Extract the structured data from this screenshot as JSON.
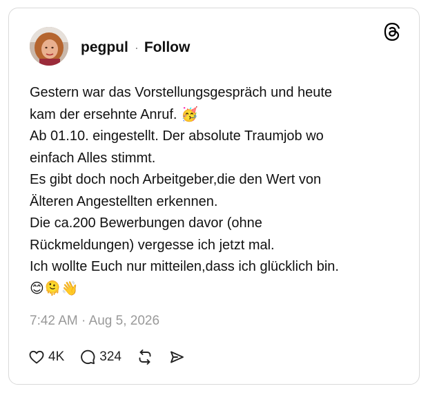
{
  "post": {
    "author": {
      "username": "pegpul",
      "follow_label": "Follow",
      "separator": "·"
    },
    "app_logo_icon": "threads-logo-icon",
    "text_lines": [
      "Gestern war das Vorstellungsgespräch und heute",
      "kam der ersehnte Anruf. 🥳",
      "Ab 01.10. eingestellt. Der absolute Traumjob wo",
      "einfach Alles stimmt.",
      "Es gibt doch noch Arbeitgeber,die den Wert von",
      "Älteren Angestellten erkennen.",
      "Die ca.200 Bewerbungen davor (ohne",
      "Rückmeldungen) vergesse ich jetzt mal.",
      "Ich wollte Euch nur mitteilen,dass ich glücklich bin."
    ],
    "emoji_line": "😊🫠👋",
    "timestamp": "7:42 AM · Aug 5, 2026",
    "actions": {
      "like_icon": "heart-icon",
      "like_count": "4K",
      "reply_icon": "comment-icon",
      "reply_count": "324",
      "repost_icon": "repost-icon",
      "share_icon": "send-icon"
    }
  }
}
